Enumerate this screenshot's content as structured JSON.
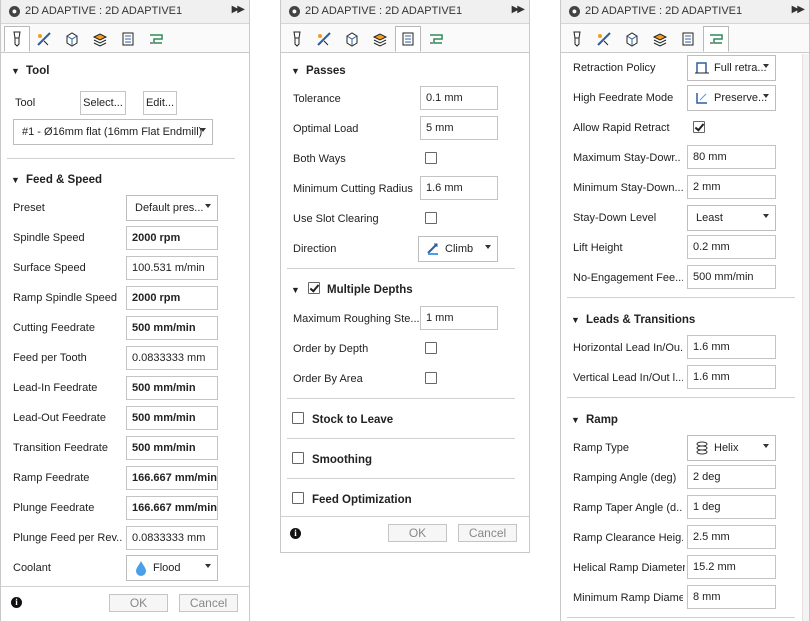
{
  "window_title": "2D ADAPTIVE : 2D ADAPTIVE1",
  "expand_icon": "double-right-arrow",
  "tabs": [
    "tool-tab",
    "geometry-tab",
    "heights-tab",
    "passes-tab",
    "linking-tab",
    "linking-alt-tab"
  ],
  "colors": {
    "accent": "#f39c1f",
    "tab_blue": "#2f5f9e",
    "coolant_blue": "#4aa0e6"
  },
  "footer": {
    "ok": "OK",
    "cancel": "Cancel"
  },
  "panel1": {
    "tool_section": "Tool",
    "tool_label": "Tool",
    "select_btn": "Select...",
    "edit_btn": "Edit...",
    "tool_value": "#1 - Ø16mm flat (16mm Flat Endmill)",
    "feed_section": "Feed & Speed",
    "rows": [
      {
        "label": "Preset",
        "value": "Default pres...",
        "type": "dropdown"
      },
      {
        "label": "Spindle Speed",
        "value": "2000 rpm",
        "type": "bold"
      },
      {
        "label": "Surface Speed",
        "value": "100.531 m/min",
        "type": "field"
      },
      {
        "label": "Ramp Spindle Speed",
        "value": "2000 rpm",
        "type": "bold"
      },
      {
        "label": "Cutting Feedrate",
        "value": "500 mm/min",
        "type": "bold"
      },
      {
        "label": "Feed per Tooth",
        "value": "0.0833333 mm",
        "type": "field"
      },
      {
        "label": "Lead-In Feedrate",
        "value": "500 mm/min",
        "type": "bold"
      },
      {
        "label": "Lead-Out Feedrate",
        "value": "500 mm/min",
        "type": "bold"
      },
      {
        "label": "Transition Feedrate",
        "value": "500 mm/min",
        "type": "bold"
      },
      {
        "label": "Ramp Feedrate",
        "value": "166.667 mm/min",
        "type": "bold"
      },
      {
        "label": "Plunge Feedrate",
        "value": "166.667 mm/min",
        "type": "bold"
      },
      {
        "label": "Plunge Feed per Rev...",
        "value": "0.0833333 mm",
        "type": "field"
      },
      {
        "label": "Coolant",
        "value": "Flood",
        "type": "dropdown-icon"
      }
    ]
  },
  "panel2": {
    "passes_section": "Passes",
    "tolerance_label": "Tolerance",
    "tolerance_value": "0.1 mm",
    "optimal_label": "Optimal Load",
    "optimal_value": "5 mm",
    "both_ways_label": "Both Ways",
    "min_radius_label": "Minimum Cutting Radius",
    "min_radius_value": "1.6 mm",
    "slot_label": "Use Slot Clearing",
    "direction_label": "Direction",
    "direction_value": "Climb",
    "multiple_depths": "Multiple Depths",
    "max_rough_label": "Maximum Roughing Ste...",
    "max_rough_value": "1 mm",
    "order_depth_label": "Order by Depth",
    "order_area_label": "Order By Area",
    "stock_label": "Stock to Leave",
    "smoothing_label": "Smoothing",
    "feed_opt_label": "Feed Optimization"
  },
  "panel3": {
    "retraction_label": "Retraction Policy",
    "retraction_value": "Full retra...",
    "high_feed_label": "High Feedrate Mode",
    "high_feed_value": "Preserve...",
    "rapid_label": "Allow Rapid Retract",
    "max_stay_label": "Maximum Stay-Dowr...",
    "max_stay_value": "80 mm",
    "min_stay_label": "Minimum Stay-Down...",
    "min_stay_value": "2 mm",
    "stay_level_label": "Stay-Down Level",
    "stay_level_value": "Least",
    "lift_label": "Lift Height",
    "lift_value": "0.2 mm",
    "noeng_label": "No-Engagement Fee...",
    "noeng_value": "500 mm/min",
    "leads_section": "Leads & Transitions",
    "hlead_label": "Horizontal Lead In/Ou...",
    "hlead_value": "1.6 mm",
    "vlead_label": "Vertical Lead In/Out l...",
    "vlead_value": "1.6 mm",
    "ramp_section": "Ramp",
    "ramp_type_label": "Ramp Type",
    "ramp_type_value": "Helix",
    "ramp_angle_label": "Ramping Angle (deg)",
    "ramp_angle_value": "2 deg",
    "ramp_taper_label": "Ramp Taper Angle (d...",
    "ramp_taper_value": "1 deg",
    "ramp_clear_label": "Ramp Clearance Heig...",
    "ramp_clear_value": "2.5 mm",
    "helical_label": "Helical Ramp Diameter",
    "helical_value": "15.2 mm",
    "min_ramp_label": "Minimum Ramp Diame...",
    "min_ramp_value": "8 mm"
  }
}
